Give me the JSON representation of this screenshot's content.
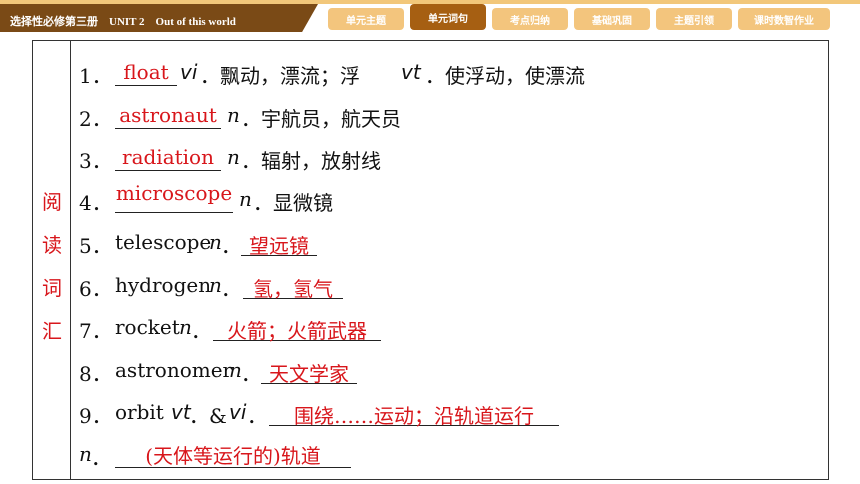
{
  "header": {
    "book_title": "选择性必修第三册　UNIT 2　Out of this world",
    "tabs": [
      {
        "label": "单元主题"
      },
      {
        "label": "单元词句"
      },
      {
        "label": "考点归纳"
      },
      {
        "label": "基础巩固"
      },
      {
        "label": "主题引领"
      },
      {
        "label": "课时数智作业"
      }
    ],
    "active_tab": "单元词句"
  },
  "side_label": [
    "阅",
    "读",
    "词",
    "汇"
  ],
  "items": [
    {
      "num": "1．",
      "answer": "float",
      "pos1": "vi",
      "pos2": "vt",
      "def1": "．飘动，漂流；浮",
      "def2": "．使浮动，使漂流"
    },
    {
      "num": "2．",
      "answer": "astronaut",
      "pos": "n",
      "def": "．宇航员，航天员"
    },
    {
      "num": "3．",
      "answer": "radiation",
      "pos": "n",
      "def": "．辐射，放射线"
    },
    {
      "num": "4．",
      "answer": "microscope",
      "pos": "n",
      "def": "．显微镜"
    },
    {
      "num": "5．",
      "word": "telescope",
      "pos": "n",
      "answer": "望远镜"
    },
    {
      "num": "6．",
      "word": "hydrogen",
      "pos": "n",
      "answer": "氢，氢气"
    },
    {
      "num": "7．",
      "word": "rocket",
      "pos": "n",
      "answer": "火箭；火箭武器"
    },
    {
      "num": "8．",
      "word": "astronomer",
      "pos": "n",
      "answer": "天文学家"
    },
    {
      "num": "9．",
      "word": "orbit",
      "pos1": "vt",
      "amp": "．&",
      "pos2": "vi",
      "answer": "围绕……运动；沿轨道运行"
    },
    {
      "num": "",
      "pos": "n",
      "answer": "(天体等运行的)轨道"
    }
  ],
  "colors": {
    "accent": "#d8161b",
    "nav_bg": "#f3c57d",
    "nav_active": "#a65f12",
    "title_bg": "#7a4a16"
  }
}
